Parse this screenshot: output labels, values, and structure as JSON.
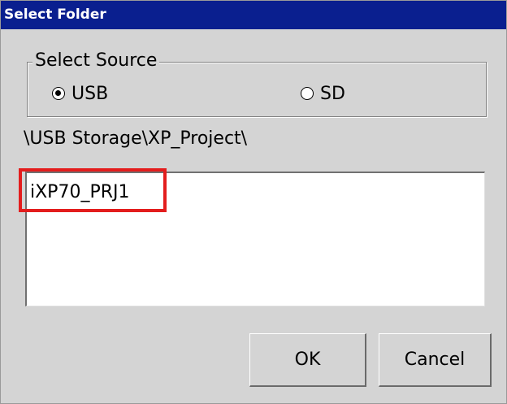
{
  "window": {
    "title": "Select Folder"
  },
  "source_group": {
    "legend": "Select Source",
    "options": [
      {
        "label": "USB",
        "selected": true
      },
      {
        "label": "SD",
        "selected": false
      }
    ]
  },
  "current_path": "\\USB Storage\\XP_Project\\",
  "folder_list": {
    "items": [
      "iXP70_PRJ1"
    ]
  },
  "buttons": {
    "ok_label": "OK",
    "cancel_label": "Cancel"
  },
  "colors": {
    "titlebar": "#0a1f8f",
    "window_bg": "#d4d4d4",
    "highlight": "#e31d1d"
  }
}
